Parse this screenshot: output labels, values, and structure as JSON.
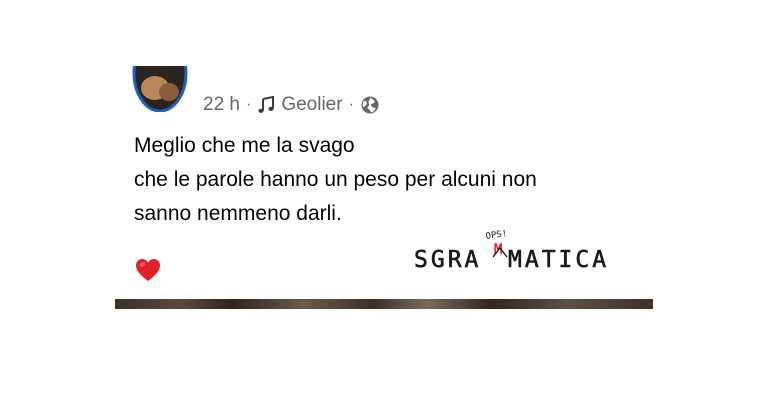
{
  "post": {
    "meta": {
      "time": "22 h",
      "separator": "·",
      "music_artist": "Geolier",
      "icons": [
        "music-note-icon",
        "globe-icon"
      ]
    },
    "text_lines": [
      "Meglio che me la svago",
      "che le parole hanno un peso per alcuni non",
      "sanno nemmeno darli."
    ],
    "reaction_icon": "red-heart-icon"
  },
  "watermark": {
    "text_left": "SGRA",
    "inserted_letter": "M",
    "text_right": "MATICA",
    "annotation": "OPS!",
    "accent_color": "#e0212b"
  },
  "colors": {
    "meta_text": "#65676b",
    "body_text": "#050505",
    "heart": "#e0212b"
  }
}
